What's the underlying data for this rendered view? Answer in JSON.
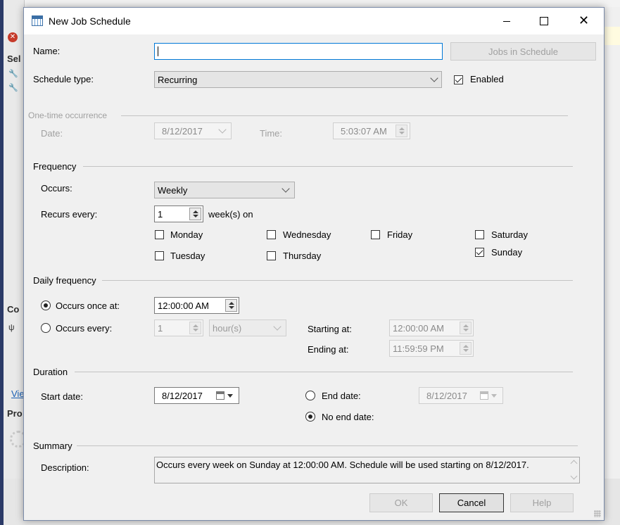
{
  "window": {
    "title": "New Job Schedule"
  },
  "background": {
    "labels": [
      "Sel",
      "Co",
      "Vie",
      "Pro"
    ]
  },
  "name_row": {
    "label": "Name:",
    "value": "",
    "jobs_button": "Jobs in Schedule"
  },
  "schedule_type": {
    "label": "Schedule type:",
    "value": "Recurring",
    "enabled_label": "Enabled",
    "enabled": true
  },
  "one_time": {
    "section": "One-time occurrence",
    "date_label": "Date:",
    "date_value": "8/12/2017",
    "time_label": "Time:",
    "time_value": "5:03:07 AM"
  },
  "frequency": {
    "section": "Frequency",
    "occurs_label": "Occurs:",
    "occurs_value": "Weekly",
    "recurs_label": "Recurs every:",
    "recurs_value": "1",
    "recurs_suffix": "week(s) on",
    "days": [
      {
        "label": "Monday",
        "checked": false
      },
      {
        "label": "Tuesday",
        "checked": false
      },
      {
        "label": "Wednesday",
        "checked": false
      },
      {
        "label": "Thursday",
        "checked": false
      },
      {
        "label": "Friday",
        "checked": false
      },
      {
        "label": "Saturday",
        "checked": false
      },
      {
        "label": "Sunday",
        "checked": true
      }
    ]
  },
  "daily": {
    "section": "Daily frequency",
    "once_label": "Occurs once at:",
    "once_value": "12:00:00 AM",
    "every_label": "Occurs every:",
    "every_value": "1",
    "every_unit": "hour(s)",
    "starting_label": "Starting at:",
    "starting_value": "12:00:00 AM",
    "ending_label": "Ending at:",
    "ending_value": "11:59:59 PM"
  },
  "duration": {
    "section": "Duration",
    "start_label": "Start date:",
    "start_value": "8/12/2017",
    "end_label": "End date:",
    "end_value": "8/12/2017",
    "no_end_label": "No end date:"
  },
  "summary": {
    "section": "Summary",
    "desc_label": "Description:",
    "desc_value": "Occurs every week on Sunday at 12:00:00 AM. Schedule will be used starting on 8/12/2017."
  },
  "buttons": {
    "ok": "OK",
    "cancel": "Cancel",
    "help": "Help"
  },
  "colors": {
    "accent": "#0078d7",
    "dialog_bg": "#f0f0f0"
  }
}
